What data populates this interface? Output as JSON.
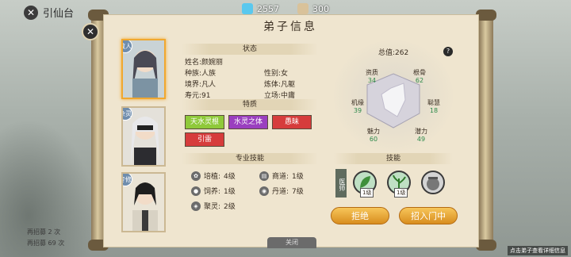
{
  "header": {
    "back_label": "引仙台"
  },
  "currency": [
    {
      "value": "2557",
      "color": "#5ac8ee"
    },
    {
      "value": "300",
      "color": "#d9c29a"
    }
  ],
  "panel": {
    "title": "弟子信息"
  },
  "portraits": [
    {
      "tag": "散人"
    },
    {
      "tag": "杂灵"
    },
    {
      "tag": "专修"
    }
  ],
  "status": {
    "header": "状态",
    "name_label": "姓名:",
    "name": "颜婉丽",
    "race_label": "种族:",
    "race": "人族",
    "gender_label": "性别:",
    "gender": "女",
    "realm_label": "境界:",
    "realm": "凡人",
    "body_label": "炼体:",
    "body": "凡躯",
    "life_label": "寿元:",
    "life": "91",
    "stance_label": "立场:",
    "stance": "中庸"
  },
  "traits": {
    "header": "特质",
    "items": [
      {
        "label": "天水灵根",
        "color": "#8fc93a"
      },
      {
        "label": "水灵之体",
        "color": "#9a3fbf"
      },
      {
        "label": "愚昧",
        "color": "#d63c3c"
      },
      {
        "label": "引雷",
        "color": "#d63c3c"
      }
    ]
  },
  "skills": {
    "header": "专业技能",
    "items": [
      {
        "icon": "sprout-icon",
        "label": "培植:",
        "level": "4级"
      },
      {
        "icon": "scroll-icon",
        "label": "商道:",
        "level": "1级"
      },
      {
        "icon": "paw-icon",
        "label": "饲养:",
        "level": "1级"
      },
      {
        "icon": "cauldron-icon",
        "label": "丹道:",
        "level": "7级"
      },
      {
        "icon": "spirit-icon",
        "label": "聚灵:",
        "level": "2级"
      }
    ]
  },
  "talent": {
    "total_label": "总值:",
    "total": "262",
    "help": "?",
    "stats": [
      {
        "name": "资质",
        "value": "34"
      },
      {
        "name": "根骨",
        "value": "62"
      },
      {
        "name": "机缘",
        "value": "39"
      },
      {
        "name": "聪慧",
        "value": "18"
      },
      {
        "name": "魅力",
        "value": "60"
      },
      {
        "name": "潜力",
        "value": "49"
      }
    ]
  },
  "techniques": {
    "header": "技能",
    "role": "医师",
    "items": [
      {
        "level": "1级"
      },
      {
        "level": "1级"
      },
      {
        "level": ""
      }
    ]
  },
  "actions": {
    "reject": "拒绝",
    "recruit": "招入门中"
  },
  "bottom_tab": "关闭",
  "hint": "点击弟子查看详细信息",
  "notes": [
    "再招募 2 次",
    "再招募 69 次"
  ]
}
